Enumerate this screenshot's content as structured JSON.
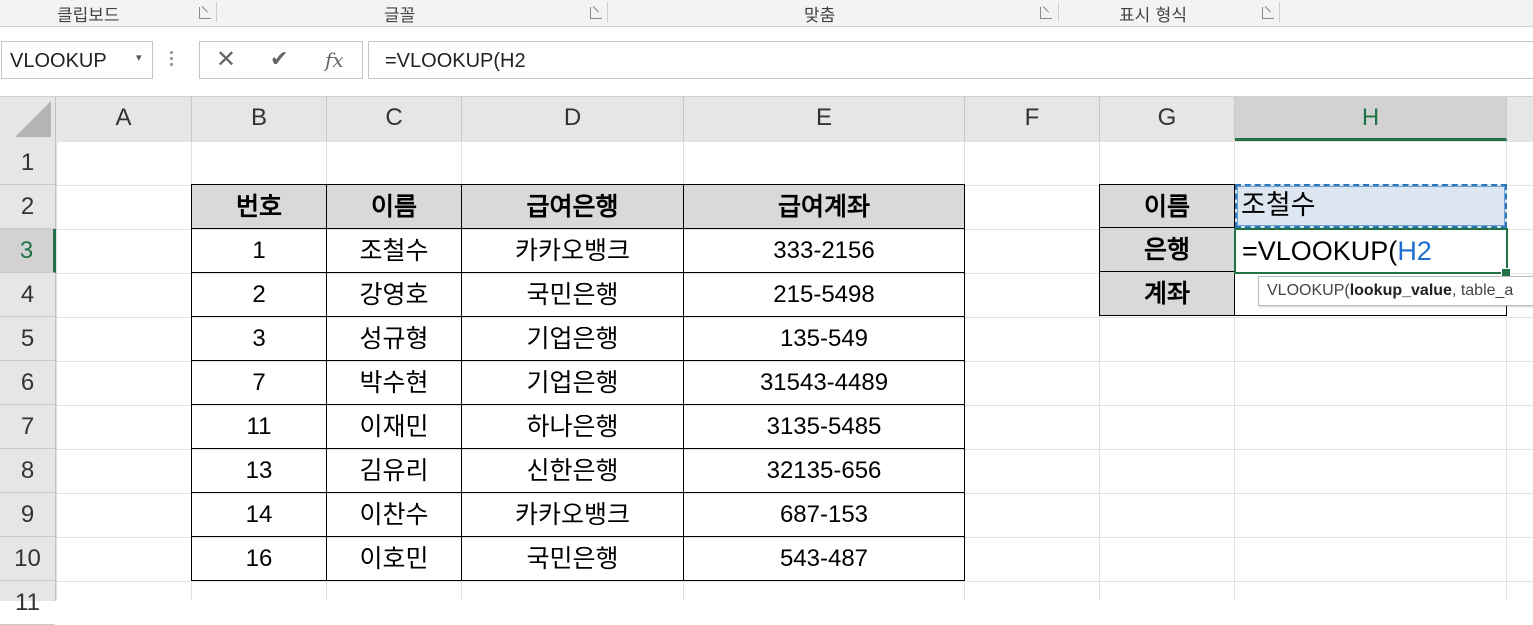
{
  "ribbon": {
    "groups": [
      {
        "label": "클립보드"
      },
      {
        "label": "글꼴"
      },
      {
        "label": "맞춤"
      },
      {
        "label": "표시 형식"
      }
    ]
  },
  "formula_bar": {
    "name_box": "VLOOKUP",
    "name_box_arrow": "▾",
    "cancel_icon": "✕",
    "enter_icon": "✔",
    "insert_function_icon": "fx",
    "formula": "=VLOOKUP(H2"
  },
  "columns": [
    "A",
    "B",
    "C",
    "D",
    "E",
    "F",
    "G",
    "H"
  ],
  "selected_column": "H",
  "rows": [
    "1",
    "2",
    "3",
    "4",
    "5",
    "6",
    "7",
    "8",
    "9",
    "10",
    "11"
  ],
  "selected_row": "3",
  "table": {
    "headers": [
      "번호",
      "이름",
      "급여은행",
      "급여계좌"
    ],
    "rows": [
      [
        "1",
        "조철수",
        "카카오뱅크",
        "333-2156"
      ],
      [
        "2",
        "강영호",
        "국민은행",
        "215-5498"
      ],
      [
        "3",
        "성규형",
        "기업은행",
        "135-549"
      ],
      [
        "7",
        "박수현",
        "기업은행",
        "31543-4489"
      ],
      [
        "11",
        "이재민",
        "하나은행",
        "3135-5485"
      ],
      [
        "13",
        "김유리",
        "신한은행",
        "32135-656"
      ],
      [
        "14",
        "이찬수",
        "카카오뱅크",
        "687-153"
      ],
      [
        "16",
        "이호민",
        "국민은행",
        "543-487"
      ]
    ]
  },
  "lookup_panel": {
    "labels": [
      "이름",
      "은행",
      "계좌"
    ],
    "name_value": "조철수",
    "editing_prefix": "=VLOOKUP(",
    "editing_ref": "H2"
  },
  "tooltip": {
    "fn": "VLOOKUP(",
    "arg_bold": "lookup_value",
    "rest": ", table_a"
  },
  "colors": {
    "accent": "#217346",
    "ref_blue": "#1f6fd1",
    "header_fill": "#d9d9d9",
    "lookup_fill": "#dce6f1"
  }
}
